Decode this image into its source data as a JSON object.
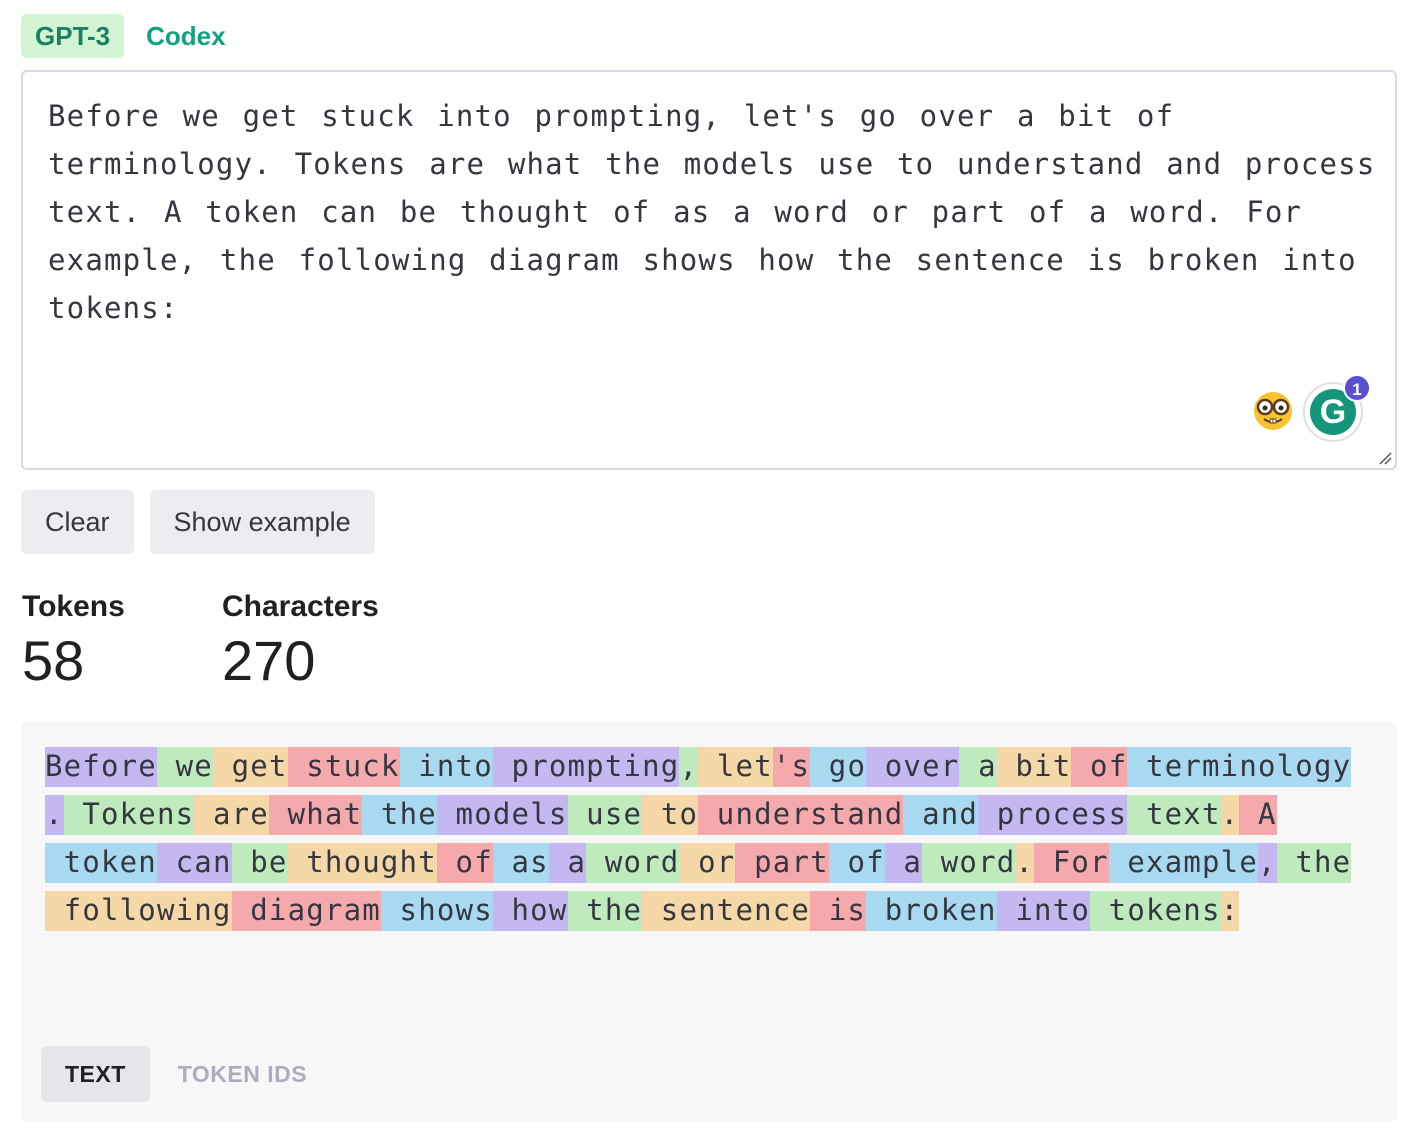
{
  "model_tabs": [
    {
      "label": "GPT-3",
      "active": true
    },
    {
      "label": "Codex",
      "active": false
    }
  ],
  "prompt": {
    "text": "Before we get stuck into prompting, let's go over a bit of terminology. Tokens are what the models use to understand and process text. A token can be thought of as a word or part of a word. For example, the following diagram shows how the sentence is broken into tokens:",
    "grammarly_badge": "1",
    "grammarly_letter": "G"
  },
  "buttons": {
    "clear": "Clear",
    "show_example": "Show example"
  },
  "stats": {
    "tokens_label": "Tokens",
    "tokens_value": "58",
    "characters_label": "Characters",
    "characters_value": "270"
  },
  "tokens": [
    "Before",
    " we",
    " get",
    " stuck",
    " into",
    " prompting",
    ",",
    " let",
    "'s",
    " go",
    " over",
    " a",
    " bit",
    " of",
    " terminology",
    ".",
    " Tokens",
    " are",
    " what",
    " the",
    " models",
    " use",
    " to",
    " understand",
    " and",
    " process",
    " text",
    ".",
    " A",
    " token",
    " can",
    " be",
    " thought",
    " of",
    " as",
    " a",
    " word",
    " or",
    " part",
    " of",
    " a",
    " word",
    ".",
    " For",
    " example",
    ",",
    " the",
    " following",
    " diagram",
    " shows",
    " how",
    " the",
    " sentence",
    " is",
    " broken",
    " into",
    " tokens",
    ":"
  ],
  "token_colors": [
    "#c5b8f0",
    "#bfeabd",
    "#f6d7a8",
    "#f5a9ac",
    "#a9d8f1"
  ],
  "view_toggle": {
    "text": "TEXT",
    "token_ids": "TOKEN IDS"
  }
}
